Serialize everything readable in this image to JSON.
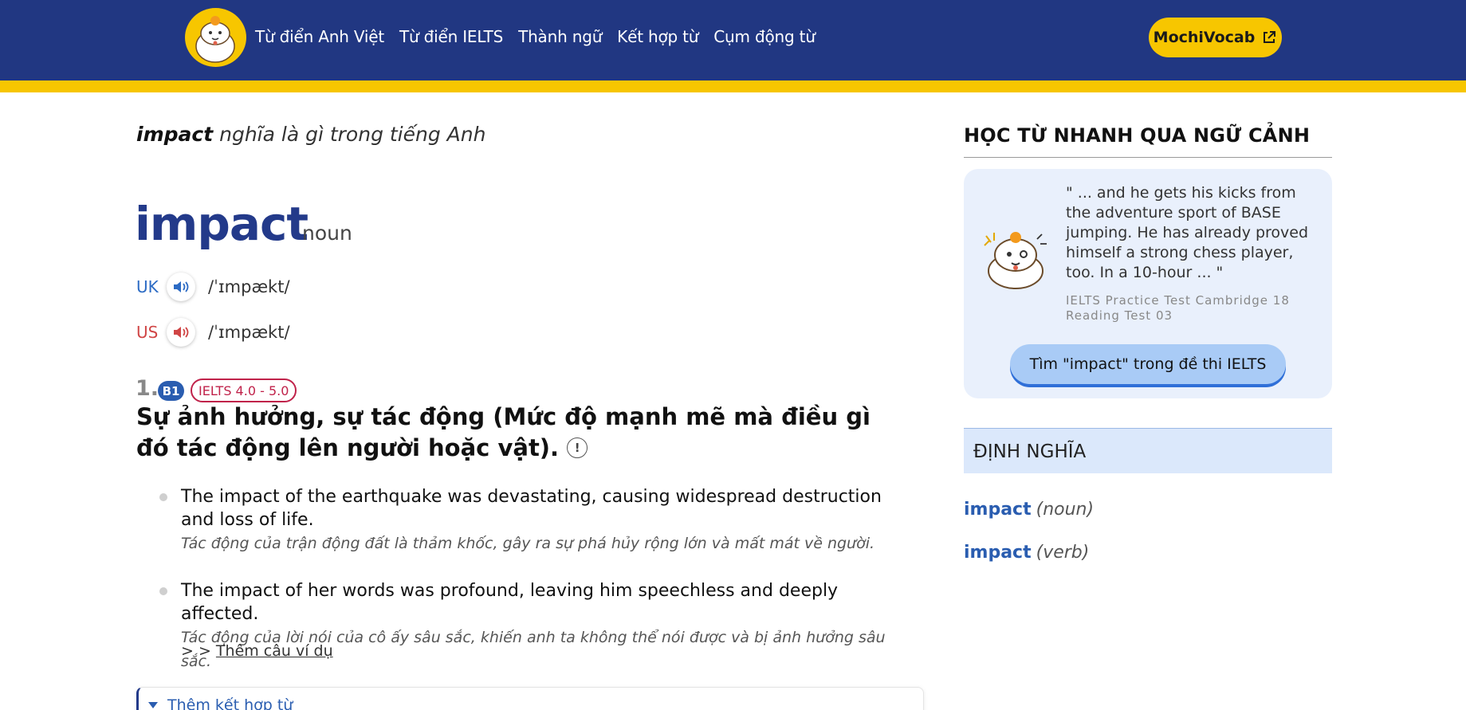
{
  "header": {
    "nav": [
      "Từ điển Anh Việt",
      "Từ điển IELTS",
      "Thành ngữ",
      "Kết hợp từ",
      "Cụm động từ"
    ],
    "cta_label": "MochiVocab",
    "colors": {
      "bar": "#213782",
      "stripe": "#f7c600",
      "cta": "#f7c600"
    }
  },
  "entry": {
    "heading_word": "impact",
    "heading_rest": " nghĩa là gì trong tiếng Anh",
    "word": "impact",
    "pos": "noun",
    "pron": [
      {
        "label": "UK",
        "ipa": "/ˈɪmpækt/",
        "icon": "speaker-icon"
      },
      {
        "label": "US",
        "ipa": "/ˈɪmpækt/",
        "icon": "speaker-icon"
      }
    ],
    "sense": {
      "number": "1.",
      "level": "B1",
      "ielts": "IELTS 4.0 - 5.0",
      "definition": "Sự ảnh hưởng, sự tác động (Mức độ mạnh mẽ mà điều gì đó tác động lên người hoặc vật).",
      "info_icon": "!"
    },
    "examples": [
      {
        "en": "The impact of the earthquake was devastating, causing widespread destruction and loss of life.",
        "vi": "Tác động của trận động đất là thảm khốc, gây ra sự phá hủy rộng lớn và mất mát về người."
      },
      {
        "en": "The impact of her words was profound, leaving him speechless and deeply affected.",
        "vi": "Tác động của lời nói của cô ấy sâu sắc, khiến anh ta không thể nói được và bị ảnh hưởng sâu sắc."
      }
    ],
    "more_prefix": "> > ",
    "more_label": "Thêm câu ví dụ",
    "collocation_label": "Thêm kết hợp từ"
  },
  "sidebar": {
    "title": "HỌC TỪ NHANH QUA NGỮ CẢNH",
    "quote": "\" ... and he gets his kicks from the adventure sport of BASE jumping. He has already proved himself a strong chess player, too. In a 10-hour ... \"",
    "source": "IELTS Practice Test Cambridge 18 Reading Test 03",
    "search_button": "Tìm \"impact\" trong đề thi IELTS",
    "def_title": "ĐỊNH NGHĨA",
    "defs": [
      {
        "word": "impact",
        "pos": "(noun)"
      },
      {
        "word": "impact",
        "pos": "(verb)"
      }
    ]
  }
}
